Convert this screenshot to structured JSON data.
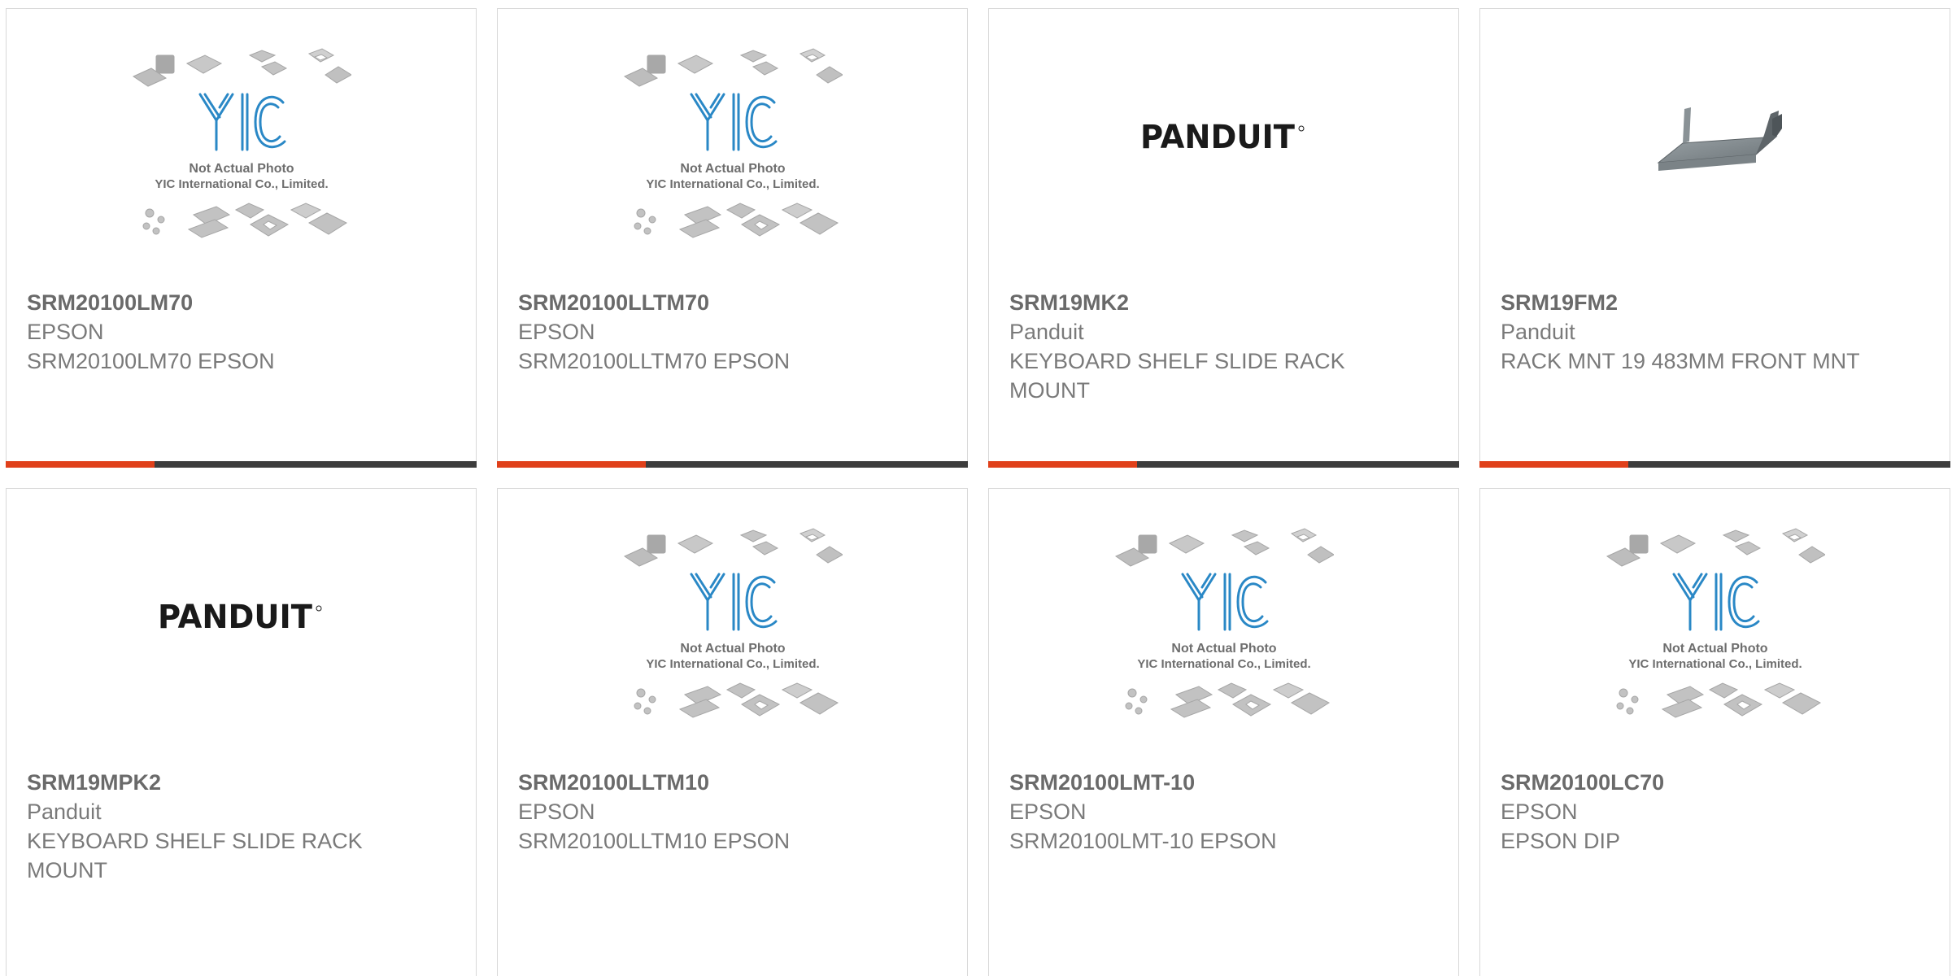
{
  "accent_color": "#e0401a",
  "bar_color": "#3d3d3d",
  "placeholder": {
    "line1": "Not Actual Photo",
    "line2": "YIC International Co., Limited."
  },
  "products": [
    {
      "part_number": "SRM20100LM70",
      "manufacturer": "EPSON",
      "description": "SRM20100LM70 EPSON",
      "image": "yic-placeholder-icon"
    },
    {
      "part_number": "SRM20100LLTM70",
      "manufacturer": "EPSON",
      "description": "SRM20100LLTM70 EPSON",
      "image": "yic-placeholder-icon"
    },
    {
      "part_number": "SRM19MK2",
      "manufacturer": "Panduit",
      "description": "KEYBOARD SHELF SLIDE RACK MOUNT",
      "image": "panduit-logo-icon",
      "logo_text": "PANDUIT"
    },
    {
      "part_number": "SRM19FM2",
      "manufacturer": "Panduit",
      "description": "RACK MNT 19 483MM FRONT MNT",
      "image": "rack-shelf-icon"
    },
    {
      "part_number": "SRM19MPK2",
      "manufacturer": "Panduit",
      "description": "KEYBOARD SHELF SLIDE RACK MOUNT",
      "image": "panduit-logo-icon",
      "logo_text": "PANDUIT"
    },
    {
      "part_number": "SRM20100LLTM10",
      "manufacturer": "EPSON",
      "description": "SRM20100LLTM10 EPSON",
      "image": "yic-placeholder-icon"
    },
    {
      "part_number": "SRM20100LMT-10",
      "manufacturer": "EPSON",
      "description": "SRM20100LMT-10 EPSON",
      "image": "yic-placeholder-icon"
    },
    {
      "part_number": "SRM20100LC70",
      "manufacturer": "EPSON",
      "description": "EPSON DIP",
      "image": "yic-placeholder-icon"
    }
  ]
}
